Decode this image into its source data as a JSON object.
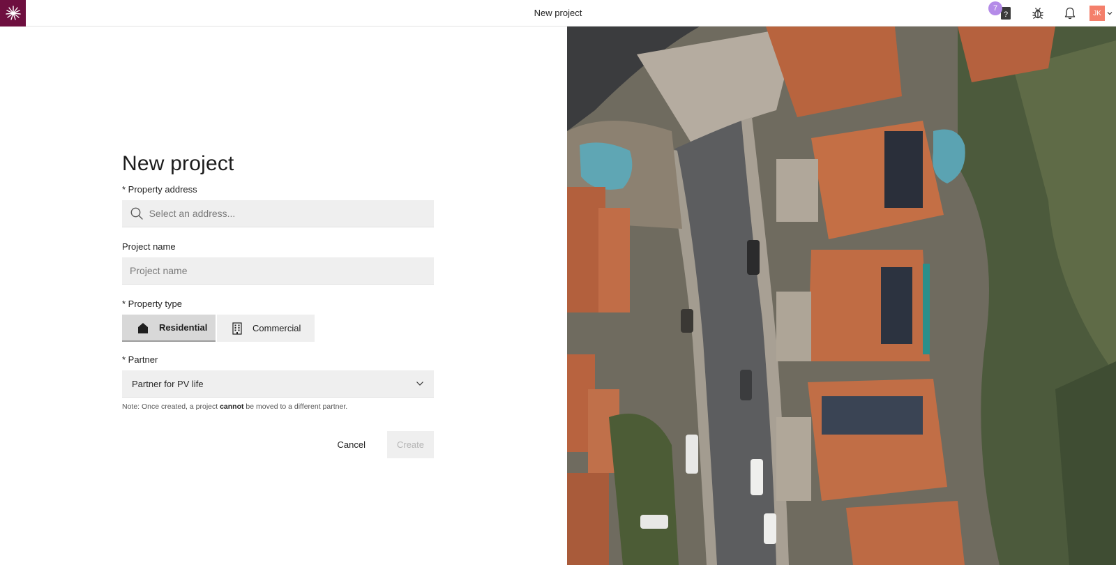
{
  "topbar": {
    "title": "New project",
    "help_badge_count": "7",
    "avatar_initials": "JK"
  },
  "form": {
    "title": "New project",
    "property_address": {
      "label": "* Property address",
      "placeholder": "Select an address..."
    },
    "project_name": {
      "label": "Project name",
      "placeholder": "Project name"
    },
    "property_type": {
      "label": "* Property type",
      "options": [
        {
          "label": "Residential",
          "selected": true,
          "icon": "home-icon"
        },
        {
          "label": "Commercial",
          "selected": false,
          "icon": "building-icon"
        }
      ]
    },
    "partner": {
      "label": "* Partner",
      "value": "Partner for PV life"
    },
    "note": {
      "prefix": "Note: Once created, a project ",
      "emphasis": "cannot",
      "suffix": " be moved to a different partner."
    },
    "actions": {
      "cancel": "Cancel",
      "create": "Create"
    }
  },
  "colors": {
    "brand": "#6e0f3f",
    "badge": "#b48be8",
    "avatar": "#f47f6b",
    "field_bg": "#efefef"
  }
}
